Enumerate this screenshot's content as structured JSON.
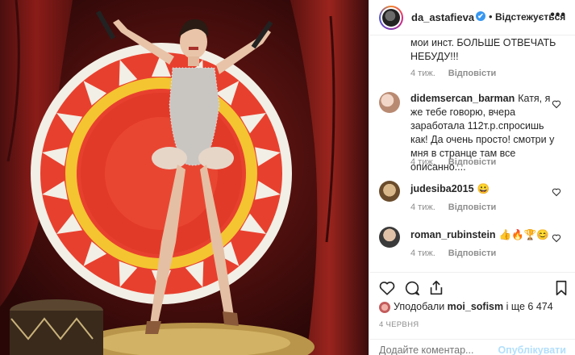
{
  "post": {
    "username": "da_astafieva",
    "verified_badge": "✔",
    "separator": "•",
    "follow_label": "Відстежується",
    "more_label": "•••"
  },
  "comments": [
    {
      "username": "",
      "text": "мои инст. БОЛЬШЕ ОТВЕЧАТЬ НЕБУДУ!!!",
      "age": "4 тиж.",
      "reply": "Відповісти"
    },
    {
      "username": "didemsercan_barman",
      "text": "Катя, я же тебе говорю, вчера заработала 112т.р.спросишь как! Да очень просто! смотри у мня в странце там все описанно....",
      "age": "4 тиж.",
      "reply": "Відповісти"
    },
    {
      "username": "judesiba2015",
      "text": "😀",
      "age": "4 тиж.",
      "reply": "Відповісти"
    },
    {
      "username": "roman_rubinstein",
      "text": "👍🔥🏆😊",
      "age": "4 тиж.",
      "reply": "Відповісти"
    }
  ],
  "likes": {
    "prefix": "Уподобали",
    "user": "moi_sofism",
    "suffix": "і ще 6 474"
  },
  "date": "4 ЧЕРВНЯ",
  "add_comment": {
    "placeholder": "Додайте коментар...",
    "publish_label": "Опублікувати"
  },
  "icons": [
    "heart-icon",
    "comment-icon",
    "share-icon",
    "bookmark-icon",
    "more-icon",
    "verified-icon"
  ],
  "colors": {
    "accent": "#3897f0",
    "publish_disabled": "#b2dffc",
    "meta": "#8e8e8e"
  }
}
